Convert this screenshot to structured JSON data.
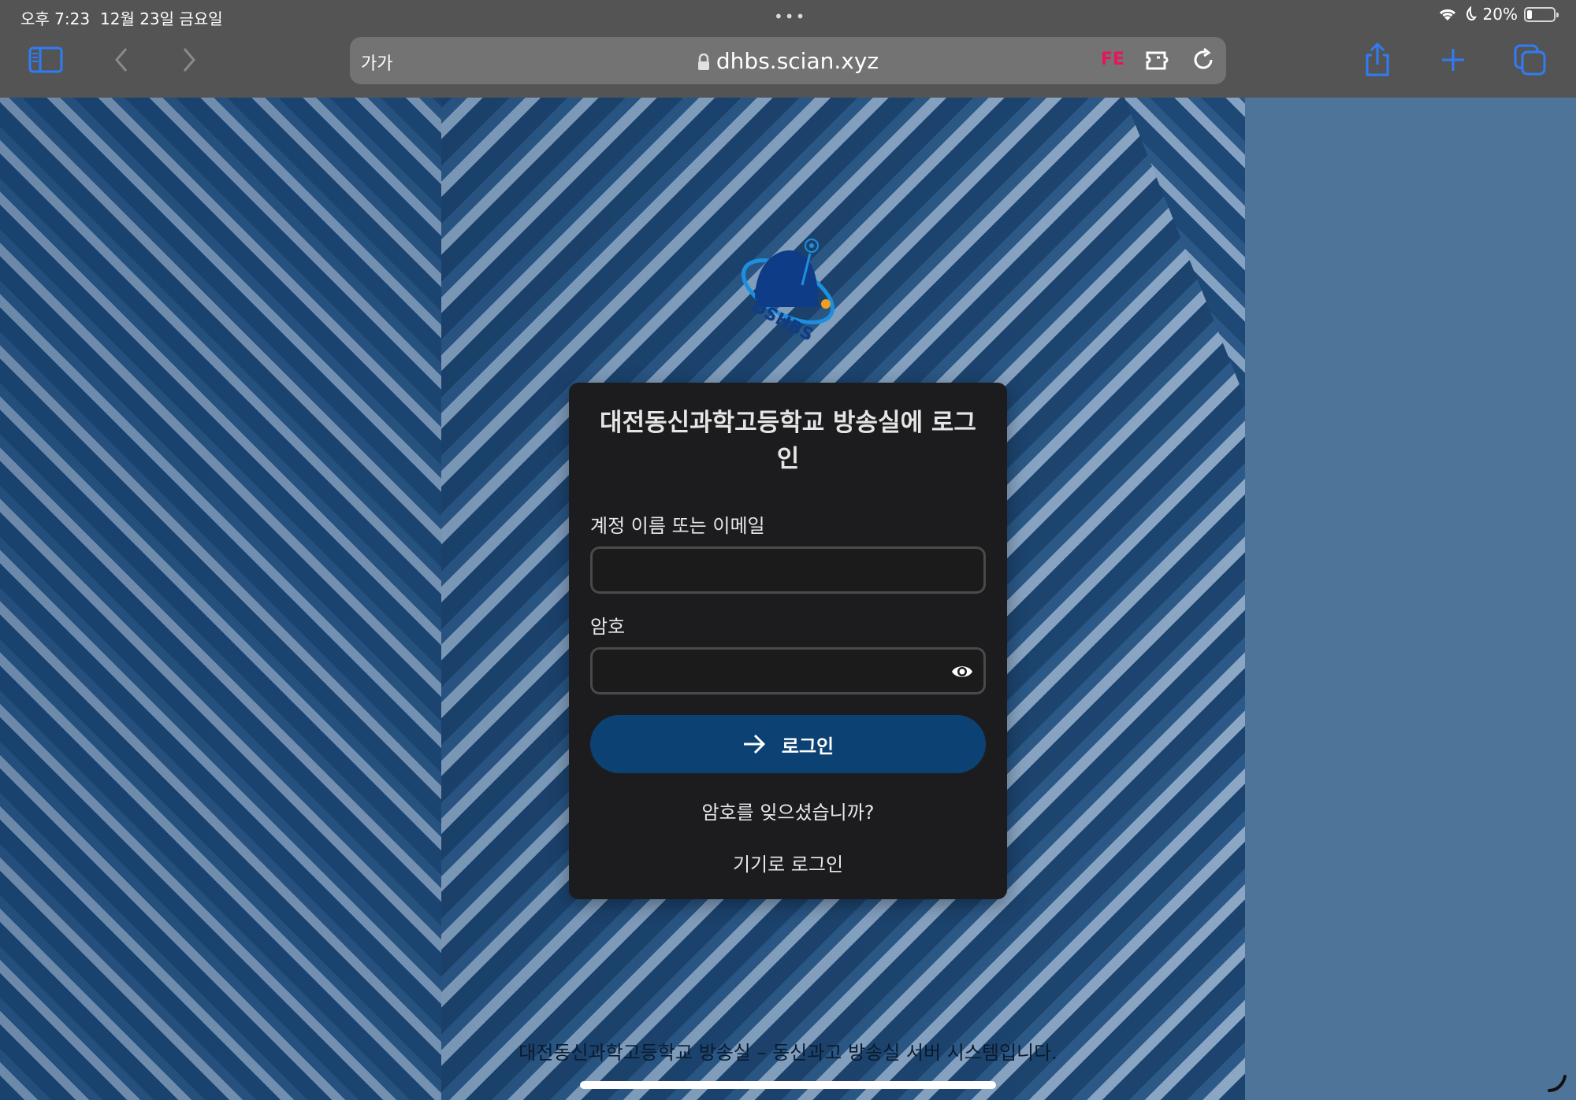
{
  "status_bar": {
    "time": "오후 7:23",
    "date": "12월 23일 금요일",
    "dots": "•••",
    "battery_percent": "20%",
    "battery_level": 0.2
  },
  "toolbar": {
    "text_size_label": "가가",
    "url": "dhbs.scian.xyz",
    "extension_badge": "FE"
  },
  "login": {
    "title": "대전동신과학고등학교 방송실에 로그인",
    "username_label": "계정 이름 또는 이메일",
    "username_value": "",
    "password_label": "암호",
    "password_value": "",
    "login_button": "로그인",
    "forgot_password": "암호를 잊으셨습니까?",
    "device_login": "기기로 로그인"
  },
  "footer": {
    "text": "대전동신과학고등학교 방송실 – 동신과고 방송실 서버 시스템입니다."
  },
  "colors": {
    "accent": "#0c4273",
    "card_bg": "#1c1c1e",
    "extension_badge": "#e5175a",
    "toolbar_icon": "#2f7df6"
  }
}
